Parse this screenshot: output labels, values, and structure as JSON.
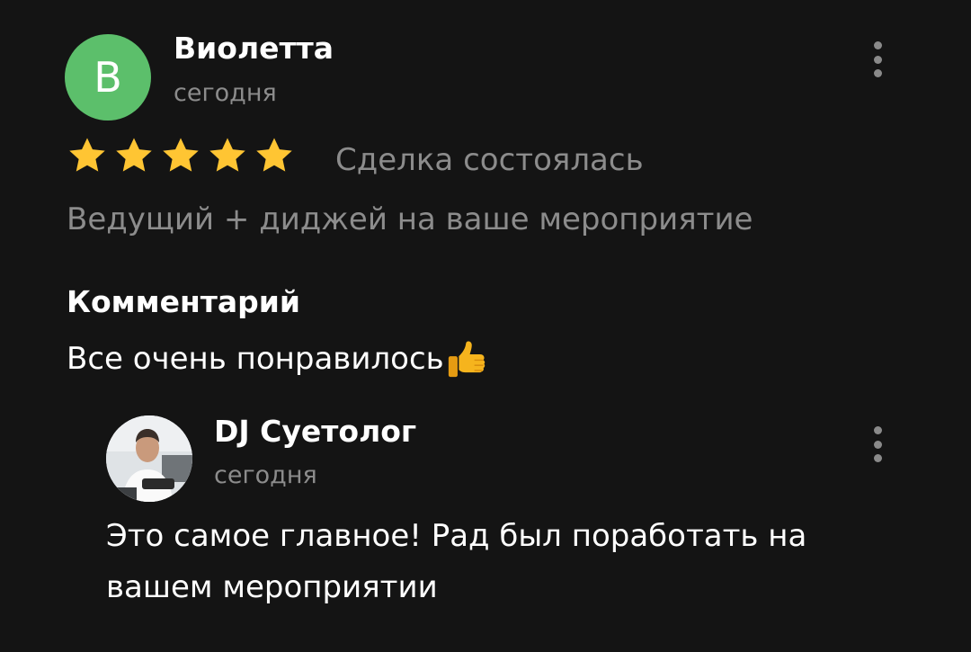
{
  "review": {
    "author_initial": "В",
    "author_name": "Виолетта",
    "date": "сегодня",
    "rating": 5,
    "rating_max": 5,
    "deal_status": "Сделка состоялась",
    "service_title": "Ведущий + диджей на ваше мероприятие",
    "comment_label": "Комментарий",
    "comment_text": "Все очень понравилось",
    "comment_emoji": "thumbs-up-icon"
  },
  "reply": {
    "author_name": "DJ Суетолог",
    "date": "сегодня",
    "text": "Это самое главное! Рад был поработать на вашем мероприятии"
  },
  "colors": {
    "background": "#141414",
    "avatar_green": "#5cbf6b",
    "star": "#ffc533",
    "muted_text": "#8c8c8c",
    "primary_text": "#ffffff"
  },
  "icons": {
    "more": "more-vertical-icon",
    "star": "star-icon"
  }
}
